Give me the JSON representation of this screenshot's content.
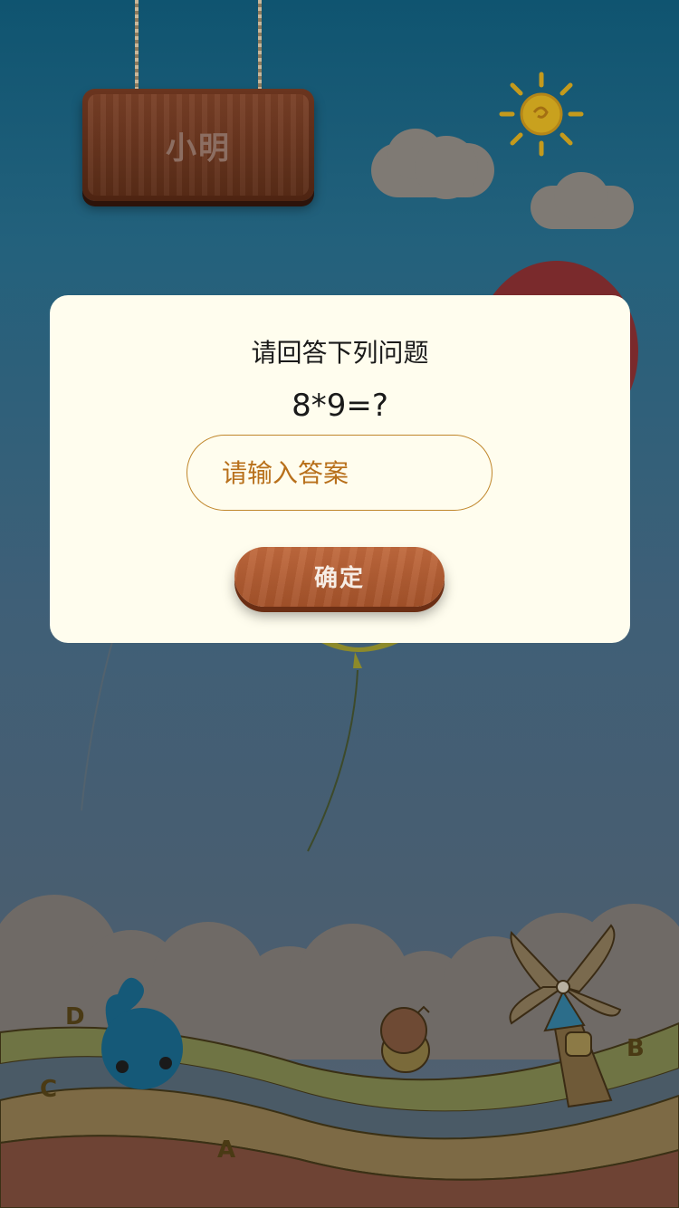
{
  "sign": {
    "name": "小明"
  },
  "dialog": {
    "title": "请回答下列问题",
    "question": "8*9=?",
    "input_placeholder": "请输入答案",
    "input_value": "",
    "confirm_label": "确定"
  },
  "lanes": {
    "a": "A",
    "b": "B",
    "c": "C",
    "d": "D"
  },
  "colors": {
    "dialog_bg": "#fffdee",
    "input_border": "#c0862b",
    "placeholder": "#b8701b",
    "button_wood": "#a4522a"
  }
}
